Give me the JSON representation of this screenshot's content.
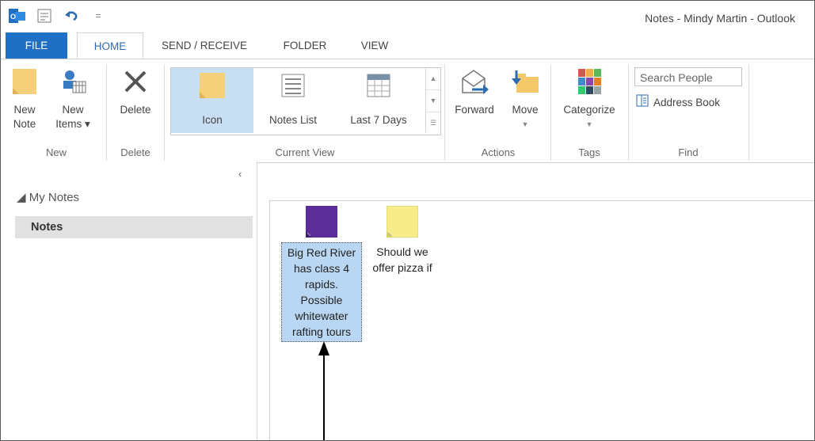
{
  "window": {
    "title": "Notes - Mindy Martin - Outlook"
  },
  "tabs": [
    "FILE",
    "HOME",
    "SEND / RECEIVE",
    "FOLDER",
    "VIEW"
  ],
  "ribbon": {
    "new_group": {
      "new_note_line1": "New",
      "new_note_line2": "Note",
      "new_items_line1": "New",
      "new_items_line2": "Items ▾",
      "label": "New"
    },
    "delete_group": {
      "delete_label": "Delete",
      "label": "Delete"
    },
    "current_view": {
      "icon": "Icon",
      "notes_list": "Notes List",
      "last7": "Last 7 Days",
      "label": "Current View"
    },
    "actions": {
      "forward": "Forward",
      "move": "Move",
      "label": "Actions"
    },
    "tags": {
      "categorize": "Categorize",
      "label": "Tags"
    },
    "find": {
      "search_placeholder": "Search People",
      "address_book": "Address Book",
      "label": "Find"
    }
  },
  "nav": {
    "collapse": "‹",
    "my_notes": "◢ My Notes",
    "notes": "Notes"
  },
  "notes": [
    {
      "color": "#5b2d99",
      "text_lines": [
        "Big Red River",
        "has class 4",
        "rapids.",
        "Possible",
        "whitewater",
        "rafting tours"
      ],
      "selected": true
    },
    {
      "color": "#f6ec8a",
      "text_lines": [
        "Should we",
        "offer pizza if"
      ],
      "selected": false
    }
  ],
  "colors": {
    "file_tab": "#1f6fc4",
    "selection": "#c8dff3",
    "note_purple": "#5b2d99",
    "note_yellow": "#f6ec8a"
  }
}
